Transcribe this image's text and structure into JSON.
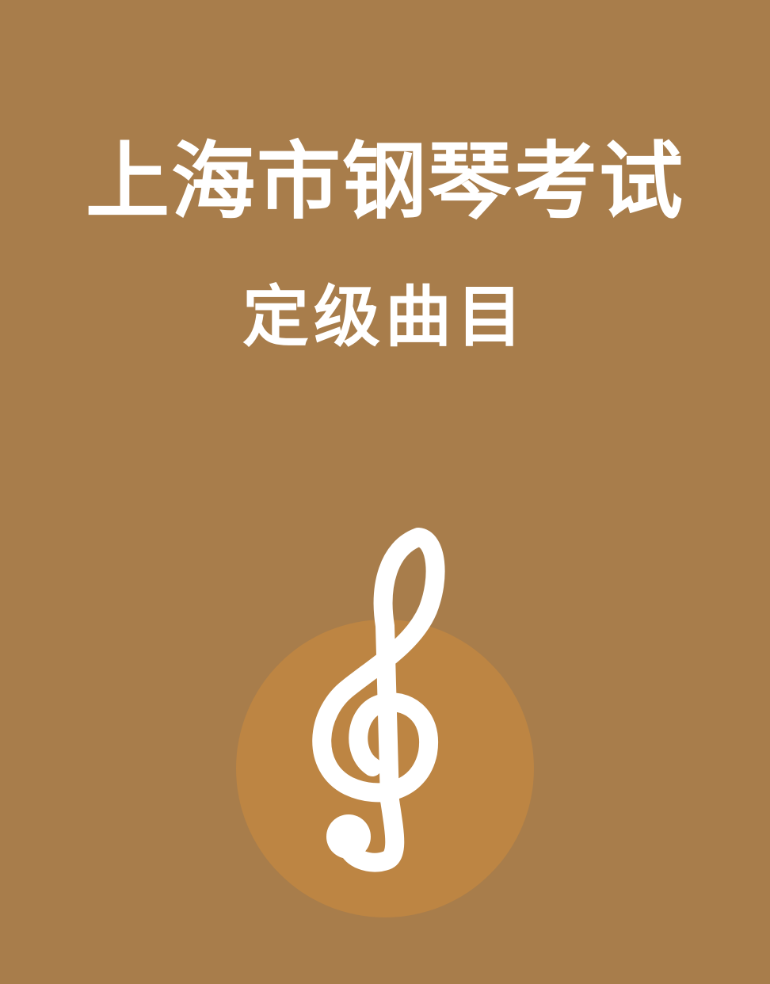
{
  "cover": {
    "title": "上海市钢琴考试",
    "subtitle": "定级曲目",
    "emblem_icon": "treble-clef-icon",
    "colors": {
      "background": "#a87d4b",
      "circle": "#bd8543",
      "text": "#ffffff"
    }
  }
}
